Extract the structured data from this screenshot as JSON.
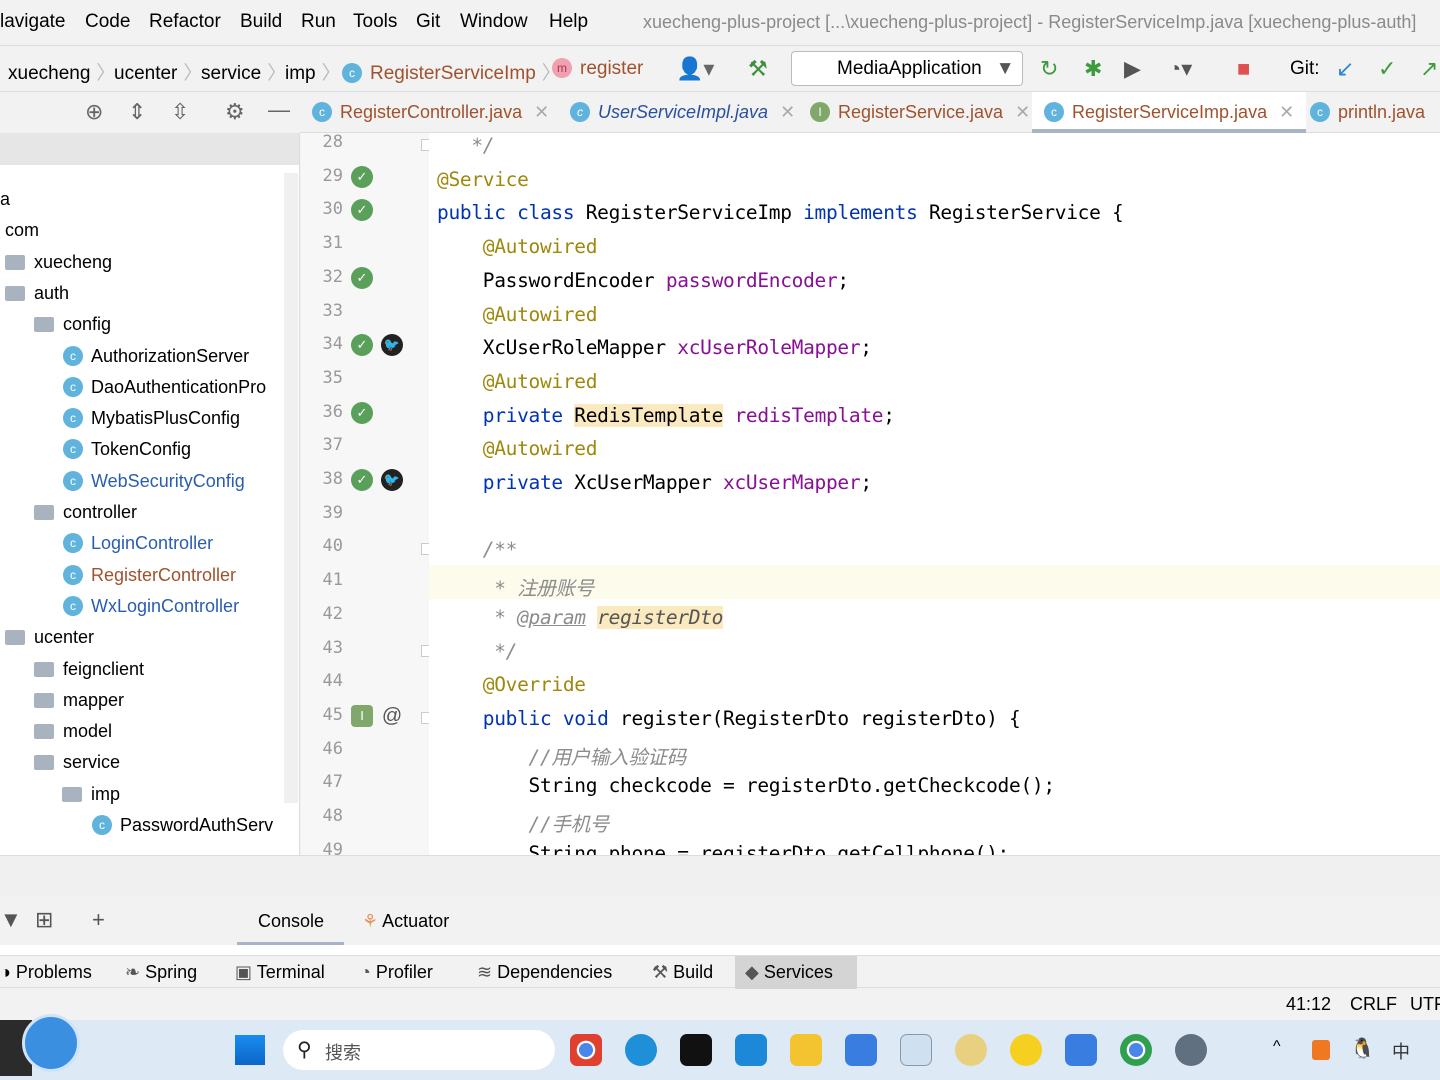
{
  "menu": [
    "lavigate",
    "Code",
    "Refactor",
    "Build",
    "Run",
    "Tools",
    "Git",
    "Window",
    "Help"
  ],
  "window_title": "xuecheng-plus-project [...\\xuecheng-plus-project] - RegisterServiceImp.java [xuecheng-plus-auth]",
  "breadcrumb": [
    "xuecheng",
    "ucenter",
    "service",
    "imp",
    "RegisterServiceImp",
    "register"
  ],
  "run_config": "MediaApplication",
  "git_label": "Git:",
  "tabs": [
    {
      "label": "RegisterController.java",
      "type": "C"
    },
    {
      "label": "UserServiceImpl.java",
      "type": "C"
    },
    {
      "label": "RegisterService.java",
      "type": "I"
    },
    {
      "label": "RegisterServiceImp.java",
      "type": "C",
      "active": true
    },
    {
      "label": "println.java",
      "type": "C"
    }
  ],
  "tree": [
    {
      "label": "a",
      "level": 0
    },
    {
      "label": "com",
      "level": 0
    },
    {
      "label": "xuecheng",
      "level": 1,
      "kind": "folder"
    },
    {
      "label": "auth",
      "level": 1,
      "kind": "folder",
      "expanded": true
    },
    {
      "label": "config",
      "level": 2,
      "kind": "folder",
      "expanded": true
    },
    {
      "label": "AuthorizationServer",
      "level": 3,
      "kind": "class"
    },
    {
      "label": "DaoAuthenticationPro",
      "level": 3,
      "kind": "class"
    },
    {
      "label": "MybatisPlusConfig",
      "level": 3,
      "kind": "class"
    },
    {
      "label": "TokenConfig",
      "level": 3,
      "kind": "class"
    },
    {
      "label": "WebSecurityConfig",
      "level": 3,
      "kind": "class",
      "color": "#2a5db0"
    },
    {
      "label": "controller",
      "level": 2,
      "kind": "folder",
      "expanded": true
    },
    {
      "label": "LoginController",
      "level": 3,
      "kind": "class",
      "color": "#2a5db0"
    },
    {
      "label": "RegisterController",
      "level": 3,
      "kind": "class",
      "color": "#a0522d"
    },
    {
      "label": "WxLoginController",
      "level": 3,
      "kind": "class",
      "color": "#2a5db0"
    },
    {
      "label": "ucenter",
      "level": 1,
      "kind": "folder",
      "expanded": true
    },
    {
      "label": "feignclient",
      "level": 2,
      "kind": "folder",
      "expanded": false
    },
    {
      "label": "mapper",
      "level": 2,
      "kind": "folder",
      "expanded": false
    },
    {
      "label": "model",
      "level": 2,
      "kind": "folder",
      "expanded": false
    },
    {
      "label": "service",
      "level": 2,
      "kind": "folder",
      "expanded": true
    },
    {
      "label": "imp",
      "level": 3,
      "kind": "folder",
      "expanded": true
    },
    {
      "label": "PasswordAuthServ",
      "level": 4,
      "kind": "class"
    }
  ],
  "code": [
    {
      "n": "28",
      "t": [
        [
          "   */",
          "cm"
        ]
      ]
    },
    {
      "n": "29",
      "t": [
        [
          "@Service",
          "an"
        ]
      ]
    },
    {
      "n": "30",
      "t": [
        [
          "public class ",
          "kw"
        ],
        [
          "RegisterServiceImp ",
          ""
        ],
        [
          "implements ",
          "kw"
        ],
        [
          "RegisterService {",
          ""
        ]
      ]
    },
    {
      "n": "31",
      "t": [
        [
          "    ",
          ""
        ],
        [
          "@Autowired",
          "an"
        ]
      ]
    },
    {
      "n": "32",
      "t": [
        [
          "    PasswordEncoder ",
          ""
        ],
        [
          "passwordEncoder",
          "fd"
        ],
        [
          ";",
          ""
        ]
      ]
    },
    {
      "n": "33",
      "t": [
        [
          "    ",
          ""
        ],
        [
          "@Autowired",
          "an"
        ]
      ]
    },
    {
      "n": "34",
      "t": [
        [
          "    XcUserRoleMapper ",
          ""
        ],
        [
          "xcUserRoleMapper",
          "fd"
        ],
        [
          ";",
          ""
        ]
      ]
    },
    {
      "n": "35",
      "t": [
        [
          "    ",
          ""
        ],
        [
          "@Autowired",
          "an"
        ]
      ]
    },
    {
      "n": "36",
      "t": [
        [
          "    ",
          ""
        ],
        [
          "private ",
          "kw"
        ],
        [
          "RedisTemplate",
          "hl"
        ],
        [
          " ",
          ""
        ],
        [
          "redisTemplate",
          "fd"
        ],
        [
          ";",
          ""
        ]
      ]
    },
    {
      "n": "37",
      "t": [
        [
          "    ",
          ""
        ],
        [
          "@Autowired",
          "an"
        ]
      ]
    },
    {
      "n": "38",
      "t": [
        [
          "    ",
          ""
        ],
        [
          "private ",
          "kw"
        ],
        [
          "XcUserMapper ",
          ""
        ],
        [
          "xcUserMapper",
          "fd"
        ],
        [
          ";",
          ""
        ]
      ]
    },
    {
      "n": "39",
      "t": []
    },
    {
      "n": "40",
      "t": [
        [
          "    /**",
          "cm"
        ]
      ]
    },
    {
      "n": "41",
      "t": [
        [
          "     * 注册账号",
          "cm"
        ]
      ]
    },
    {
      "n": "42",
      "t": [
        [
          "     * ",
          "cm"
        ],
        [
          "@param",
          "tg"
        ],
        [
          " ",
          ""
        ],
        [
          "registerDto",
          "pm"
        ]
      ]
    },
    {
      "n": "43",
      "t": [
        [
          "     */",
          "cm"
        ]
      ]
    },
    {
      "n": "44",
      "t": [
        [
          "    ",
          ""
        ],
        [
          "@Override",
          "an"
        ]
      ]
    },
    {
      "n": "45",
      "t": [
        [
          "    ",
          ""
        ],
        [
          "public void ",
          "kw"
        ],
        [
          "register(RegisterDto registerDto) {",
          ""
        ]
      ]
    },
    {
      "n": "46",
      "t": [
        [
          "        //用户输入验证码",
          "cm"
        ]
      ]
    },
    {
      "n": "47",
      "t": [
        [
          "        String checkcode = registerDto.getCheckcode();",
          ""
        ]
      ]
    },
    {
      "n": "48",
      "t": [
        [
          "        //手机号",
          "cm"
        ]
      ]
    },
    {
      "n": "49",
      "t": [
        [
          "        String phone = registerDto.getCellphone();",
          ""
        ]
      ]
    }
  ],
  "current_line": "41",
  "service_tabs": [
    "Console",
    "Actuator"
  ],
  "tool_windows": [
    "Problems",
    "Spring",
    "Terminal",
    "Profiler",
    "Dependencies",
    "Build",
    "Services"
  ],
  "active_tool_window": "Services",
  "status": {
    "position": "41:12",
    "line_sep": "CRLF",
    "encoding": "UTF"
  },
  "taskbar": {
    "search_placeholder": "搜索",
    "tray": [
      "^",
      "中"
    ]
  }
}
